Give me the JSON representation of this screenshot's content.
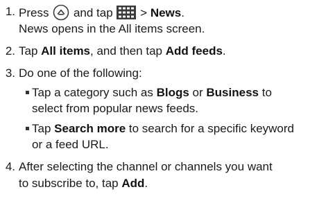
{
  "steps": [
    {
      "number": "1.",
      "line1_before": "Press",
      "line1_mid": "and tap",
      "line1_arrow": ">",
      "line1_target": "News",
      "line1_end": ".",
      "line2": "News opens in the All items screen."
    },
    {
      "number": "2.",
      "t1": "Tap",
      "b1": "All items",
      "t2": ", and then tap",
      "b2": "Add feeds",
      "t3": "."
    },
    {
      "number": "3.",
      "text": "Do one of the following:",
      "bullets": [
        {
          "t1": "Tap a category such as",
          "b1": "Blogs",
          "t2": "or",
          "b2": "Business",
          "t3": "to",
          "line2": "select from popular news feeds."
        },
        {
          "t1": "Tap",
          "b1": "Search more",
          "t2": "to search for a specific keyword",
          "line2": "or a feed URL."
        }
      ]
    },
    {
      "number": "4.",
      "line1": "After selecting the channel or channels you want",
      "line2_before": "to subscribe to, tap",
      "line2_bold": "Add",
      "line2_end": "."
    }
  ],
  "icons": {
    "home": "home-icon",
    "grid": "all-apps-grid-icon"
  },
  "colors": {
    "text": "#1a1a1a",
    "icon_fill": "#3a3a3a"
  }
}
